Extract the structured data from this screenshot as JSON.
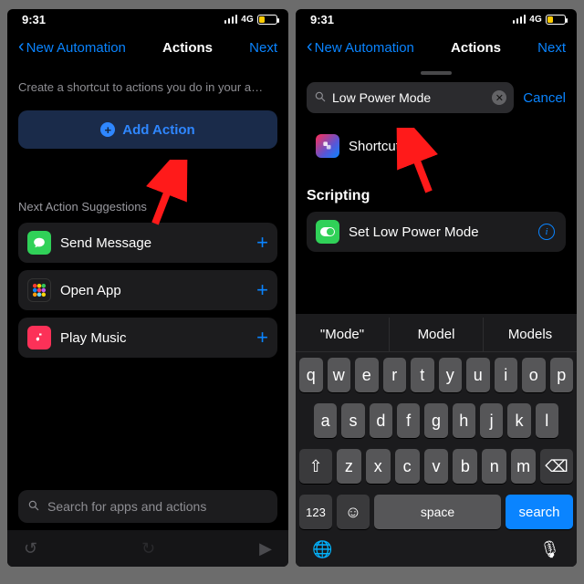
{
  "status": {
    "time": "9:31",
    "network": "4G"
  },
  "left": {
    "back": "New Automation",
    "title": "Actions",
    "next": "Next",
    "hint": "Create a shortcut to actions you do in your a…",
    "add_action": "Add Action",
    "suggest_header": "Next Action Suggestions",
    "suggestions": [
      {
        "label": "Send Message",
        "icon": "messages"
      },
      {
        "label": "Open App",
        "icon": "apps"
      },
      {
        "label": "Play Music",
        "icon": "music"
      }
    ],
    "search_placeholder": "Search for apps and actions"
  },
  "right": {
    "back": "New Automation",
    "title": "Actions",
    "next": "Next",
    "search_value": "Low Power Mode",
    "cancel": "Cancel",
    "shortcuts_label": "Shortcuts",
    "scripting_header": "Scripting",
    "result_label": "Set Low Power Mode",
    "kb": {
      "suggestions": [
        "\"Mode\"",
        "Model",
        "Models"
      ],
      "row1": [
        "q",
        "w",
        "e",
        "r",
        "t",
        "y",
        "u",
        "i",
        "o",
        "p"
      ],
      "row2": [
        "a",
        "s",
        "d",
        "f",
        "g",
        "h",
        "j",
        "k",
        "l"
      ],
      "row3": [
        "z",
        "x",
        "c",
        "v",
        "b",
        "n",
        "m"
      ],
      "shift": "⇧",
      "backspace": "⌫",
      "numbers": "123",
      "emoji": "☺",
      "space": "space",
      "search": "search",
      "globe": "🌐",
      "mic": "🎙"
    }
  }
}
